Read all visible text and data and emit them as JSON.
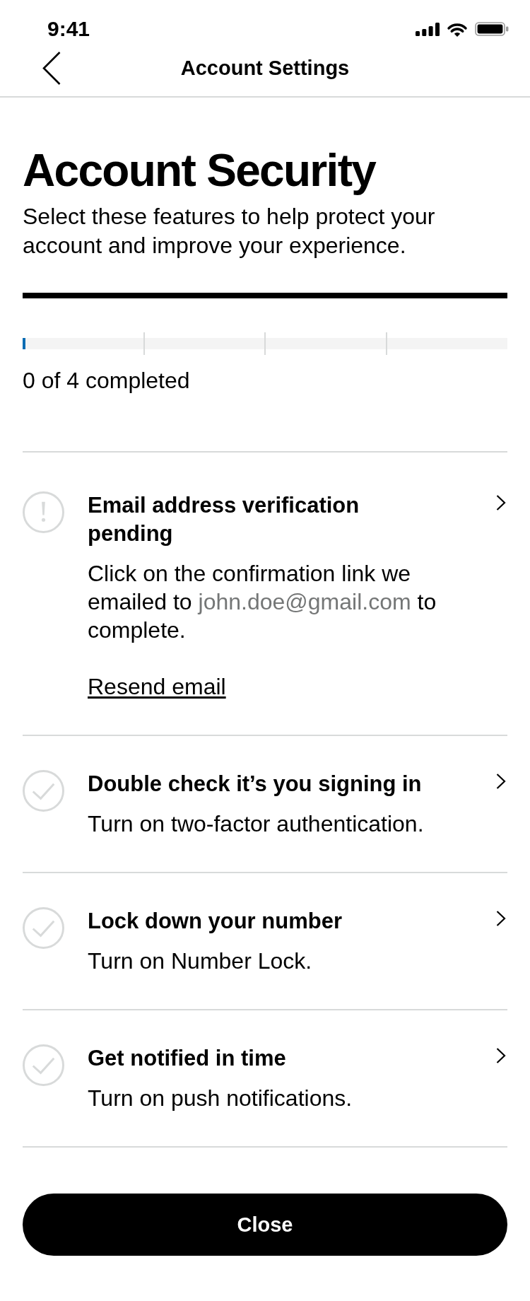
{
  "status_bar": {
    "time": "9:41"
  },
  "nav_bar": {
    "title": "Account Settings"
  },
  "header": {
    "title": "Account Security",
    "subtitle": "Select these features to help protect your account and improve your experience."
  },
  "progress": {
    "level": 0,
    "label": "0 of 4 completed"
  },
  "tasks": [
    {
      "kind": "pending",
      "completed": false,
      "title": "Email address verification pending",
      "description": [
        {
          "kind": "text",
          "text": "Click on the confirmation link we emailed to"
        },
        {
          "kind": "email",
          "text": "john.doe@gmail.com"
        },
        {
          "kind": "text",
          "text": "to complete."
        }
      ],
      "action": "Resend email"
    },
    {
      "kind": "todo",
      "completed": false,
      "title": "Double check it’s you signing in",
      "description": [
        {
          "kind": "text",
          "text": "Turn on two-factor authentication."
        }
      ]
    },
    {
      "kind": "todo",
      "completed": false,
      "title": "Lock down your number",
      "description": [
        {
          "kind": "text",
          "text": "Turn on Number Lock."
        }
      ]
    },
    {
      "kind": "todo",
      "completed": false,
      "title": "Get notified in time",
      "description": [
        {
          "kind": "text",
          "text": "Turn on push notifications."
        }
      ]
    }
  ],
  "close_button": {
    "label": "Close"
  }
}
